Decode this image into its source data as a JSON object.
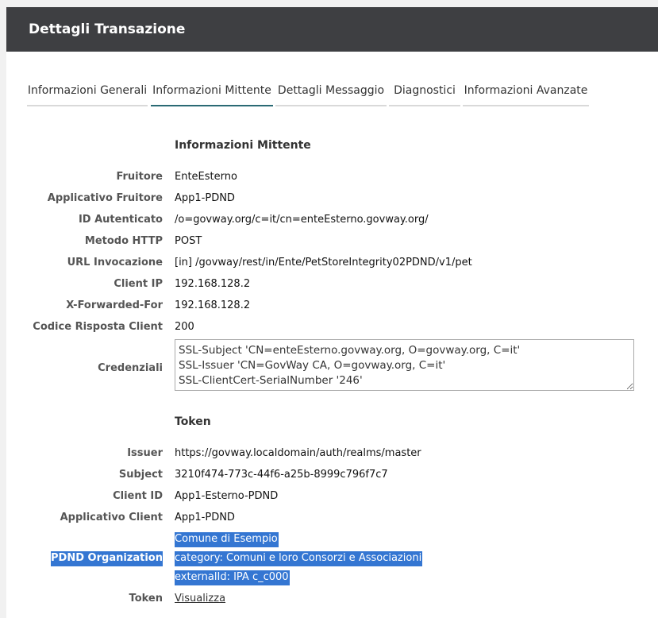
{
  "header": {
    "title": "Dettagli Transazione"
  },
  "tabs": [
    {
      "label": "Informazioni Generali"
    },
    {
      "label": "Informazioni Mittente"
    },
    {
      "label": "Dettagli Messaggio"
    },
    {
      "label": "Diagnostici"
    },
    {
      "label": "Informazioni Avanzate"
    }
  ],
  "mittente": {
    "title": "Informazioni Mittente",
    "rows": [
      {
        "label": "Fruitore",
        "value": "EnteEsterno"
      },
      {
        "label": "Applicativo Fruitore",
        "value": "App1-PDND"
      },
      {
        "label": "ID Autenticato",
        "value": "/o=govway.org/c=it/cn=enteEsterno.govway.org/"
      },
      {
        "label": "Metodo HTTP",
        "value": "POST"
      },
      {
        "label": "URL Invocazione",
        "value": "[in] /govway/rest/in/Ente/PetStoreIntegrity02PDND/v1/pet"
      },
      {
        "label": "Client IP",
        "value": "192.168.128.2"
      },
      {
        "label": "X-Forwarded-For",
        "value": "192.168.128.2"
      },
      {
        "label": "Codice Risposta Client",
        "value": "200"
      }
    ],
    "credenziali": {
      "label": "Credenziali",
      "value": "SSL-Subject 'CN=enteEsterno.govway.org, O=govway.org, C=it'\nSSL-Issuer 'CN=GovWay CA, O=govway.org, C=it'\nSSL-ClientCert-SerialNumber '246'"
    }
  },
  "token": {
    "title": "Token",
    "rows": [
      {
        "label": "Issuer",
        "value": "https://govway.localdomain/auth/realms/master"
      },
      {
        "label": "Subject",
        "value": "3210f474-773c-44f6-a25b-8999c796f7c7"
      },
      {
        "label": "Client ID",
        "value": "App1-Esterno-PDND"
      },
      {
        "label": "Applicativo Client",
        "value": "App1-PDND"
      }
    ],
    "pdnd": {
      "label": "PDND Organization",
      "lines": [
        "Comune di Esempio",
        "category: Comuni e loro Consorzi e Associazioni",
        "externalId: IPA c_c000"
      ]
    },
    "token_row": {
      "label": "Token",
      "link": "Visualizza"
    }
  },
  "colors": {
    "header_bg": "#3e3f42",
    "active_tab": "#2a6a74",
    "selection": "#3476d2"
  }
}
